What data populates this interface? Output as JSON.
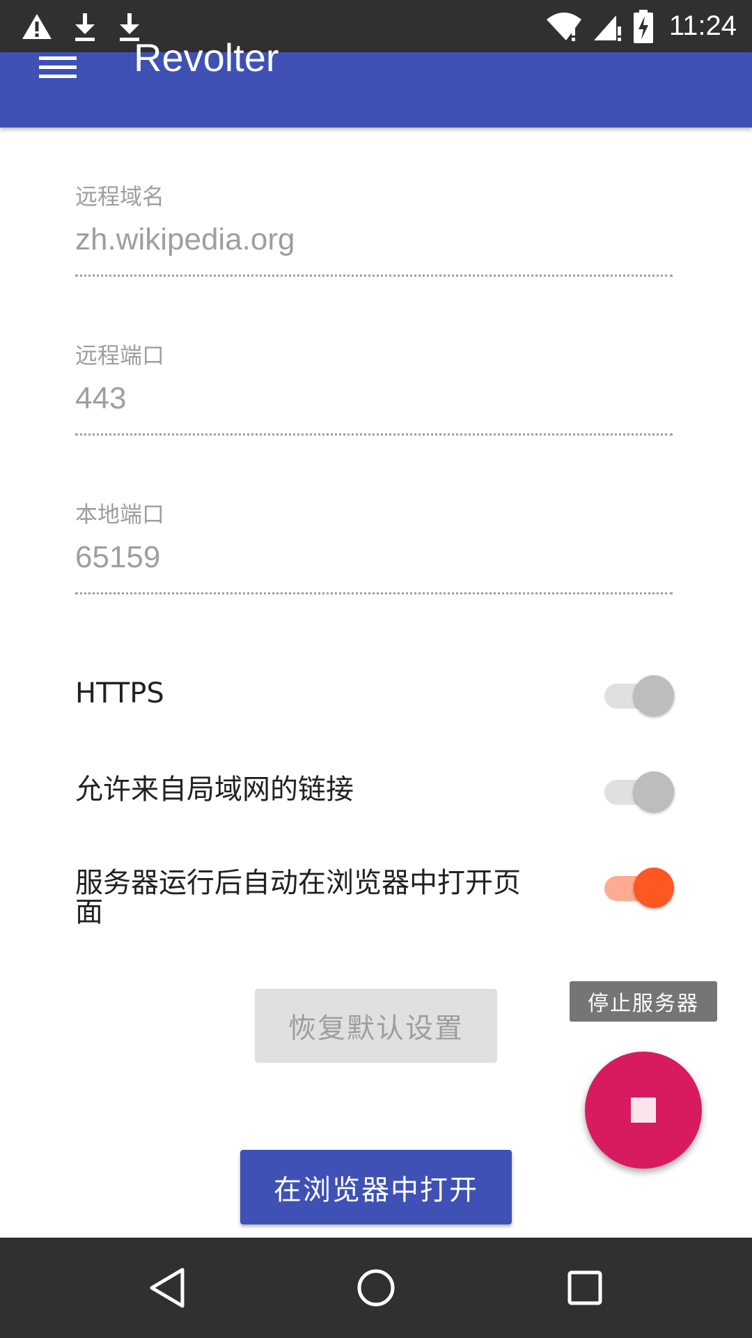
{
  "status_bar": {
    "time": "11:24",
    "left_icons": [
      "warning-icon",
      "download-icon",
      "download-icon"
    ],
    "right_icons": [
      "wifi-icon",
      "signal-icon",
      "battery-charging-icon"
    ]
  },
  "app_bar": {
    "title": "Revolter",
    "menu_icon": "menu-icon"
  },
  "form": {
    "remote_domain": {
      "label": "远程域名",
      "value": "zh.wikipedia.org"
    },
    "remote_port": {
      "label": "远程端口",
      "value": "443"
    },
    "local_port": {
      "label": "本地端口",
      "value": "65159"
    }
  },
  "toggles": [
    {
      "label": "HTTPS",
      "checked": false
    },
    {
      "label": "允许来自局域网的链接",
      "checked": false
    },
    {
      "label": "服务器运行后自动在浏览器中打开页面",
      "checked": true
    }
  ],
  "buttons": {
    "reset": "恢复默认设置",
    "open_in_browser": "在浏览器中打开"
  },
  "fab": {
    "tooltip": "停止服务器",
    "icon": "stop-icon"
  },
  "colors": {
    "primary": "#3f51b5",
    "accent": "#ff5722",
    "fab": "#d81b60"
  },
  "nav_bar": [
    "back-icon",
    "home-icon",
    "recents-icon"
  ]
}
